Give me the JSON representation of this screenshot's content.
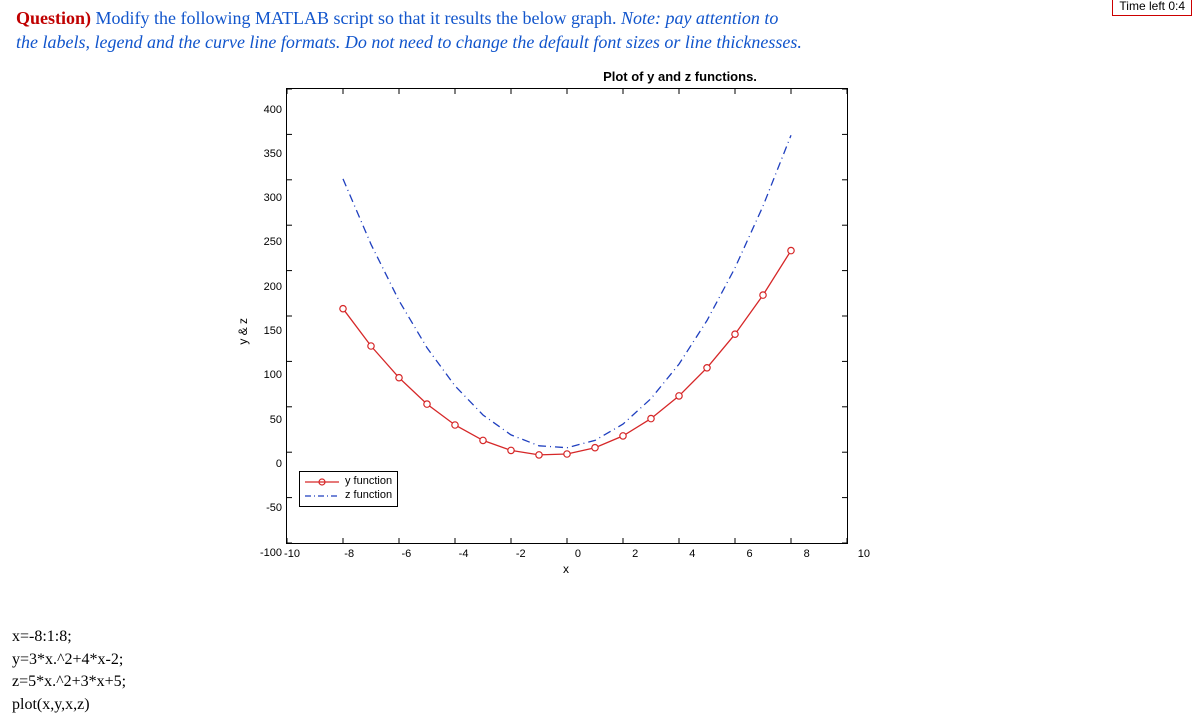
{
  "timer_text": "Time left 0:4",
  "question": {
    "label": "Question)",
    "body_part1": " Modify the following MATLAB script so that it results the below graph. ",
    "note_label": "Note: pay attention to",
    "note_rest": "the labels, legend and the curve line formats. Do not need to change the default font sizes or line thicknesses."
  },
  "chart_data": {
    "type": "line",
    "title": "Plot of y and z functions.",
    "xlabel": "x",
    "ylabel": "y & z",
    "xlim": [
      -10,
      10
    ],
    "ylim": [
      -100,
      400
    ],
    "xticks": [
      -10,
      -8,
      -6,
      -4,
      -2,
      0,
      2,
      4,
      6,
      8,
      10
    ],
    "yticks": [
      -100,
      -50,
      0,
      50,
      100,
      150,
      200,
      250,
      300,
      350,
      400
    ],
    "x": [
      -8,
      -7,
      -6,
      -5,
      -4,
      -3,
      -2,
      -1,
      0,
      1,
      2,
      3,
      4,
      5,
      6,
      7,
      8
    ],
    "series": [
      {
        "name": "y function",
        "color": "#d62728",
        "style": "solid-circle",
        "values": [
          158,
          117,
          82,
          53,
          30,
          13,
          2,
          -3,
          -2,
          5,
          18,
          37,
          62,
          93,
          130,
          173,
          222
        ]
      },
      {
        "name": "z function",
        "color": "#1f3fbf",
        "style": "dash-dot",
        "values": [
          301,
          229,
          167,
          115,
          73,
          41,
          19,
          7,
          5,
          13,
          31,
          59,
          97,
          145,
          203,
          271,
          349
        ]
      }
    ],
    "legend_position": "lower-left"
  },
  "legend": {
    "entry1": "y function",
    "entry2": "z function"
  },
  "code": {
    "line1": "x=-8:1:8;",
    "line2": "y=3*x.^2+4*x-2;",
    "line3": "z=5*x.^2+3*x+5;",
    "line4": "plot(x,y,x,z)"
  }
}
